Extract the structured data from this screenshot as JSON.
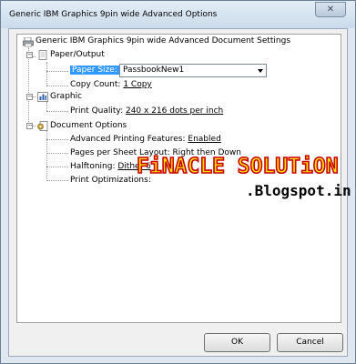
{
  "window": {
    "title": "Generic IBM Graphics 9pin wide Advanced Options",
    "close_glyph": "✕"
  },
  "tree": {
    "root": {
      "label": "Generic IBM Graphics 9pin wide Advanced Document Settings",
      "icon": "printer-document-icon"
    },
    "paper_output": {
      "label": "Paper/Output",
      "icon": "paper-icon",
      "paper_size_label": "Paper Size:",
      "paper_size_value": "PassbookNew1",
      "copy_count_label": "Copy Count:",
      "copy_count_value": "1 Copy"
    },
    "graphic": {
      "label": "Graphic",
      "icon": "graphic-chart-icon",
      "print_quality_label": "Print Quality:",
      "print_quality_value": "240 x 216 dots per inch"
    },
    "document_options": {
      "label": "Document Options",
      "icon": "document-options-icon",
      "advanced_features_label": "Advanced Printing Features:",
      "advanced_features_value": "Enabled",
      "pages_per_sheet_label": "Pages per Sheet Layout:",
      "pages_per_sheet_value": "Right then Down",
      "halftoning_label": "Halftoning:",
      "halftoning_value": "Dither 6",
      "print_optimizations_label": "Print Optimizations:"
    }
  },
  "buttons": {
    "ok": "OK",
    "cancel": "Cancel"
  },
  "watermark": {
    "title": "FiNACLE SOLUTiON",
    "subtitle": ".Blogspot.in"
  },
  "colors": {
    "selection": "#3399ff",
    "watermark_fill": "#ffe100",
    "watermark_stroke": "#c70000"
  }
}
